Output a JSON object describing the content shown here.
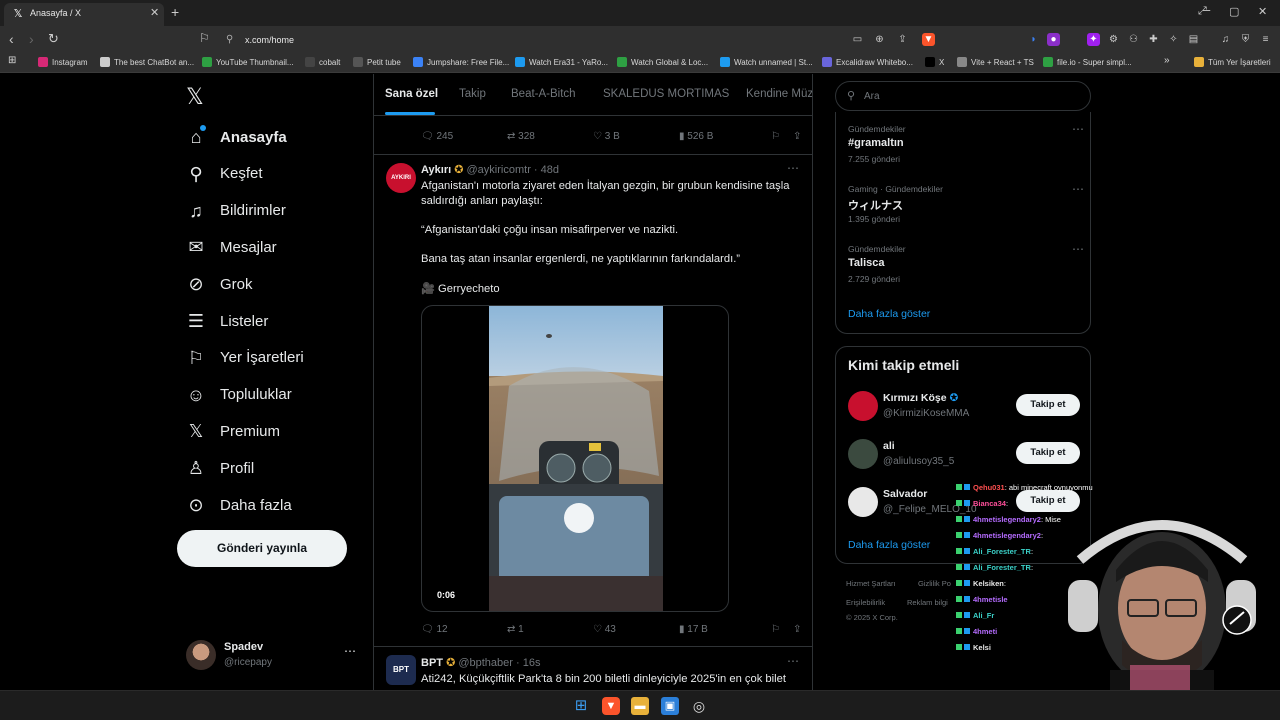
{
  "browser": {
    "tab_title": "Anasayfa / X",
    "url": "x.com/home",
    "bookmarks": [
      {
        "label": "Instagram",
        "color": "#d62976"
      },
      {
        "label": "The best ChatBot an...",
        "color": "#cccccc"
      },
      {
        "label": "YouTube Thumbnail...",
        "color": "#2ea043"
      },
      {
        "label": "cobalt",
        "color": "#444444"
      },
      {
        "label": "Petit tube",
        "color": "#555555"
      },
      {
        "label": "Jumpshare: Free File...",
        "color": "#3b82f6"
      },
      {
        "label": "Watch Era31 - YaRo...",
        "color": "#1d9bf0"
      },
      {
        "label": "Watch Global & Loc...",
        "color": "#2ea043"
      },
      {
        "label": "Watch unnamed | St...",
        "color": "#1d9bf0"
      },
      {
        "label": "Excalidraw Whitebo...",
        "color": "#6965db"
      },
      {
        "label": "X",
        "color": "#000000"
      },
      {
        "label": "Vite + React + TS",
        "color": "#888888"
      },
      {
        "label": "file.io - Super simpl...",
        "color": "#2ea043"
      }
    ],
    "all_bookmarks": "Tüm Yer İşaretleri"
  },
  "nav": {
    "items": [
      {
        "label": "Anasayfa",
        "icon": "home-icon"
      },
      {
        "label": "Keşfet",
        "icon": "search-icon"
      },
      {
        "label": "Bildirimler",
        "icon": "bell-icon"
      },
      {
        "label": "Mesajlar",
        "icon": "mail-icon"
      },
      {
        "label": "Grok",
        "icon": "grok-icon"
      },
      {
        "label": "Listeler",
        "icon": "list-icon"
      },
      {
        "label": "Yer İşaretleri",
        "icon": "bookmark-icon"
      },
      {
        "label": "Topluluklar",
        "icon": "communities-icon"
      },
      {
        "label": "Premium",
        "icon": "x-icon"
      },
      {
        "label": "Profil",
        "icon": "user-icon"
      },
      {
        "label": "Daha fazla",
        "icon": "more-icon"
      }
    ],
    "post_button": "Gönderi yayınla",
    "account": {
      "name": "Spadev",
      "handle": "@ricepapy"
    }
  },
  "feed": {
    "tabs": [
      "Sana özel",
      "Takip",
      "Beat-A-Bitch",
      "SKALEDUS MORTIMAS",
      "Kendine Müz"
    ],
    "prev_tweet_actions": {
      "replies": "245",
      "retweets": "328",
      "likes": "3 B",
      "views": "526 B"
    },
    "tweet": {
      "avatar_text": "AYKIRI",
      "name": "Aykırı",
      "handle": "@aykiricomtr",
      "time": "48d",
      "text1": "Afganistan'ı motorla ziyaret eden İtalyan gezgin, bir grubun kendisine taşla saldırdığı anları paylaştı:",
      "text2": "“Afganistan'daki çoğu insan misafirperver ve nazikti.",
      "text3": "Bana taş atan insanlar ergenlerdi, ne yaptıklarının farkındalardı.”",
      "text4": "🎥 Gerryecheto",
      "video_time": "0:06",
      "replies": "12",
      "retweets": "1",
      "likes": "43",
      "views": "17 B"
    },
    "next_tweet": {
      "avatar_text": "BPT",
      "name": "BPT",
      "handle": "@bpthaber",
      "time": "16s",
      "text": "Ati242, Küçükçiftlik Park'ta 8 bin 200 biletli dinleyiciyle 2025'in en çok bilet"
    }
  },
  "sidebar": {
    "search_placeholder": "Ara",
    "trends": [
      {
        "category": "Gündemdekiler",
        "name": "#gramaltın",
        "count": "7.255 gönderi"
      },
      {
        "category": "Gaming · Gündemdekiler",
        "name": "ウィルナス",
        "count": "1.395 gönderi"
      },
      {
        "category": "Gündemdekiler",
        "name": "Talisca",
        "count": "2.729 gönderi"
      }
    ],
    "show_more": "Daha fazla göster",
    "who_to_follow": "Kimi takip etmeli",
    "follow_label": "Takip et",
    "suggestions": [
      {
        "name": "Kırmızı Köşe",
        "handle": "@KirmiziKoseMMA",
        "color": "#c8102e"
      },
      {
        "name": "ali",
        "handle": "@aliulusoy35_5",
        "color": "#3b4a3f"
      },
      {
        "name": "Salvador",
        "handle": "@_Felipe_MELO_10",
        "color": "#e8e8e8"
      }
    ],
    "show_more2": "Daha fazla göster",
    "footer": [
      "Hizmet Şartları",
      "Gizlilik Po",
      "Erişilebilirlik",
      "Reklam bilgi",
      "© 2025 X Corp."
    ]
  },
  "stream_chat": [
    {
      "user": "Qehu031",
      "msg": ": abi minecraft oynuyonmu",
      "color": "#ff4f4f"
    },
    {
      "user": "Bianca34",
      "msg": ": ",
      "color": "#ff4f9a"
    },
    {
      "user": "4hmetislegendary2",
      "msg": ": Mise",
      "color": "#b56cff"
    },
    {
      "user": "4hmetislegendary2",
      "msg": ": ",
      "color": "#b56cff"
    },
    {
      "user": "Ali_Forester_TR",
      "msg": ": ",
      "color": "#3bd1c8"
    },
    {
      "user": "Ali_Forester_TR",
      "msg": ": ",
      "color": "#3bd1c8"
    },
    {
      "user": "Kelsiken",
      "msg": ": ",
      "color": "#e8e8e8"
    },
    {
      "user": "4hmetisle",
      "msg": "",
      "color": "#b56cff"
    },
    {
      "user": "Ali_Fr",
      "msg": "",
      "color": "#3bd1c8"
    },
    {
      "user": "4hmeti",
      "msg": "",
      "color": "#b56cff"
    },
    {
      "user": "Kelsi",
      "msg": "",
      "color": "#e8e8e8"
    }
  ]
}
